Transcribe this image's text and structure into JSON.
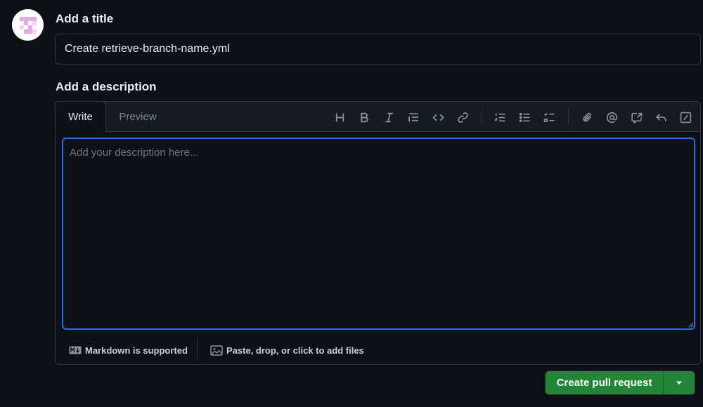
{
  "form": {
    "title_label": "Add a title",
    "title_value": "Create retrieve-branch-name.yml",
    "description_label": "Add a description"
  },
  "editor": {
    "tabs": [
      {
        "label": "Write",
        "active": true
      },
      {
        "label": "Preview",
        "active": false
      }
    ],
    "toolbar": [
      {
        "name": "heading-icon"
      },
      {
        "name": "bold-icon"
      },
      {
        "name": "italic-icon"
      },
      {
        "name": "quote-icon"
      },
      {
        "name": "code-icon"
      },
      {
        "name": "link-icon"
      },
      {
        "name": "numbered-list-icon"
      },
      {
        "name": "unordered-list-icon"
      },
      {
        "name": "task-list-icon"
      },
      {
        "name": "attach-icon"
      },
      {
        "name": "mention-icon"
      },
      {
        "name": "cross-reference-icon"
      },
      {
        "name": "reply-icon"
      },
      {
        "name": "slash-commands-icon"
      }
    ],
    "placeholder": "Add your description here...",
    "footer": {
      "markdown_label": "Markdown is supported",
      "files_label": "Paste, drop, or click to add files"
    }
  },
  "actions": {
    "submit_label": "Create pull request"
  },
  "colors": {
    "background": "#0d1117",
    "border": "#30363d",
    "focus": "#1f6feb",
    "primary_button": "#238636"
  }
}
